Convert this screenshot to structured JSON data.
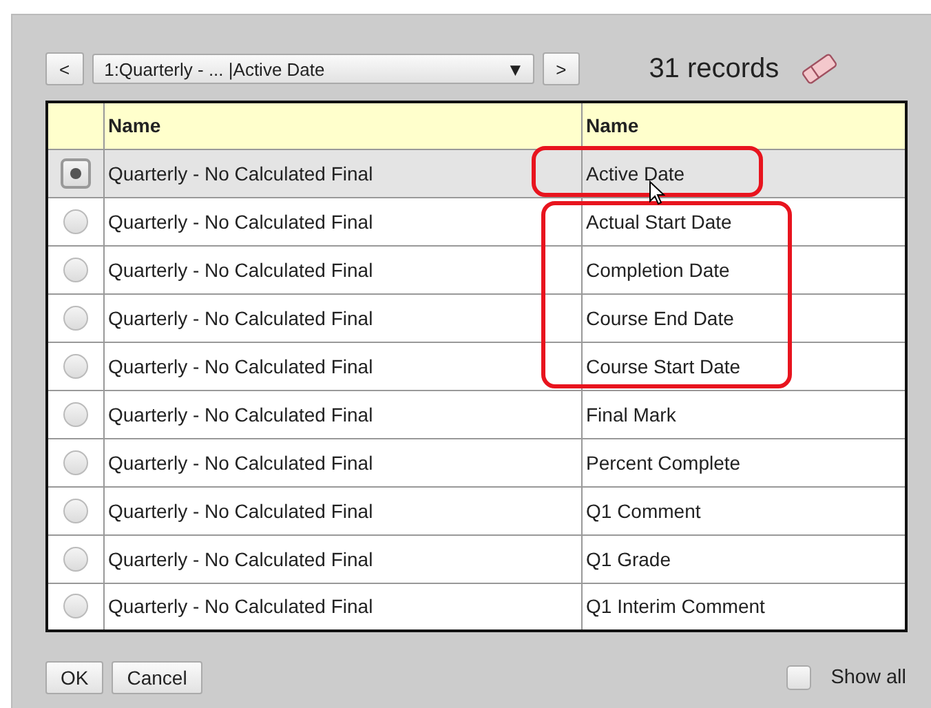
{
  "toolbar": {
    "prev": "<",
    "select_value": "1:Quarterly - ... |Active Date",
    "select_arrow": "▼",
    "next": ">",
    "record_count": "31 records"
  },
  "table": {
    "columns": [
      "Name",
      "Name"
    ],
    "rows": [
      {
        "selected": true,
        "cells": [
          "Quarterly - No Calculated Final",
          "Active Date"
        ],
        "outlined": true,
        "pointer_over": true
      },
      {
        "selected": false,
        "cells": [
          "Quarterly - No Calculated Final",
          "Actual Start Date"
        ],
        "outlined": true,
        "outline_starts": true
      },
      {
        "selected": false,
        "cells": [
          "Quarterly - No Calculated Final",
          "Completion Date"
        ],
        "outlined": true,
        "outline_starts": false
      },
      {
        "selected": false,
        "cells": [
          "Quarterly - No Calculated Final",
          "Course End Date"
        ],
        "outlined": true,
        "outline_starts": false
      },
      {
        "selected": false,
        "cells": [
          "Quarterly - No Calculated Final",
          "Course Start Date"
        ],
        "outlined": true,
        "outline_starts": false
      },
      {
        "selected": false,
        "cells": [
          "Quarterly - No Calculated Final",
          "Final Mark"
        ]
      },
      {
        "selected": false,
        "cells": [
          "Quarterly - No Calculated Final",
          "Percent Complete"
        ]
      },
      {
        "selected": false,
        "cells": [
          "Quarterly - No Calculated Final",
          "Q1 Comment"
        ]
      },
      {
        "selected": false,
        "cells": [
          "Quarterly - No Calculated Final",
          "Q1 Grade"
        ]
      },
      {
        "selected": false,
        "cells": [
          "Quarterly - No Calculated Final",
          "Q1 Interim Comment"
        ]
      }
    ]
  },
  "footer": {
    "buttons": [
      "OK",
      "Cancel"
    ],
    "show_all": {
      "label": "Show all",
      "checked": false
    }
  }
}
